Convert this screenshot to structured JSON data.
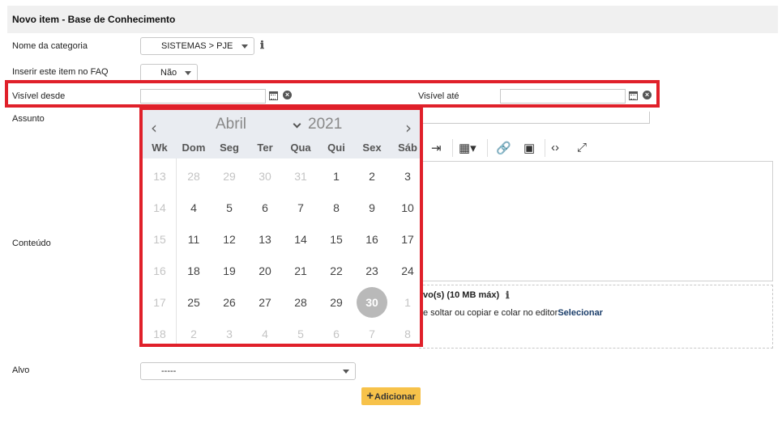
{
  "header": {
    "title": "Novo item - Base de Conhecimento"
  },
  "form": {
    "categoria": {
      "label": "Nome da categoria",
      "value": "SISTEMAS > PJE"
    },
    "faq": {
      "label": "Inserir este item no FAQ",
      "value": "Não"
    },
    "visivel_desde": {
      "label": "Visível desde",
      "value": ""
    },
    "visivel_ate": {
      "label": "Visível até",
      "value": ""
    },
    "assunto": {
      "label": "Assunto"
    },
    "conteudo": {
      "label": "Conteúdo"
    },
    "anexo": {
      "title": "vo(s) (10 MB máx)",
      "desc": "e soltar ou copiar e colar no editor",
      "link": "Selecionar"
    },
    "alvo": {
      "label": "Alvo",
      "value": "-----"
    },
    "add_button": {
      "label": "Adicionar"
    }
  },
  "datepicker": {
    "month": "Abril",
    "year": "2021",
    "prev": "‹",
    "next": "›",
    "weekdays": [
      "Wk",
      "Dom",
      "Seg",
      "Ter",
      "Qua",
      "Qui",
      "Sex",
      "Sáb"
    ],
    "weeks": [
      {
        "wk": "13",
        "days": [
          "28",
          "29",
          "30",
          "31",
          "1",
          "2",
          "3"
        ]
      },
      {
        "wk": "14",
        "days": [
          "4",
          "5",
          "6",
          "7",
          "8",
          "9",
          "10"
        ]
      },
      {
        "wk": "15",
        "days": [
          "11",
          "12",
          "13",
          "14",
          "15",
          "16",
          "17"
        ]
      },
      {
        "wk": "16",
        "days": [
          "18",
          "19",
          "20",
          "21",
          "22",
          "23",
          "24"
        ]
      },
      {
        "wk": "17",
        "days": [
          "25",
          "26",
          "27",
          "28",
          "29",
          "30",
          "1"
        ]
      },
      {
        "wk": "18",
        "days": [
          "2",
          "3",
          "4",
          "5",
          "6",
          "7",
          "8"
        ]
      }
    ],
    "selected": "30"
  },
  "colors": {
    "accent_red": "#e0202a",
    "button_yellow": "#f7c24a",
    "link_blue": "#1a3d6a"
  }
}
